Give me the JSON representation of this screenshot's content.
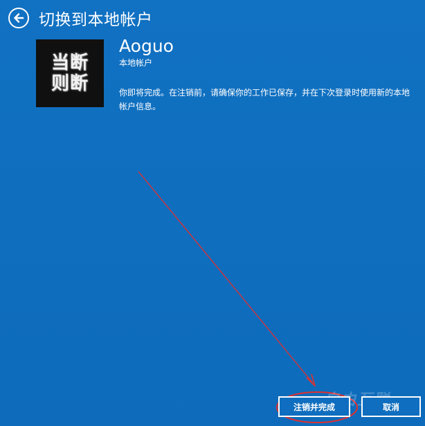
{
  "header": {
    "title": "切换到本地帐户",
    "back_icon": "back-arrow-icon"
  },
  "account": {
    "avatar_lines": [
      "当断",
      "则断"
    ],
    "name": "Aoguo",
    "type": "本地帐户",
    "message": "你即将完成。在注销前，请确保你的工作已保存，并在下次登录时使用新的本地帐户信息。"
  },
  "buttons": {
    "signout_finish_label": "注销并完成",
    "cancel_label": "取消"
  },
  "watermark": {
    "text": "自由互联"
  },
  "colors": {
    "background": "#0f6ebf",
    "text": "#ffffff",
    "annotation": "#e03030"
  }
}
